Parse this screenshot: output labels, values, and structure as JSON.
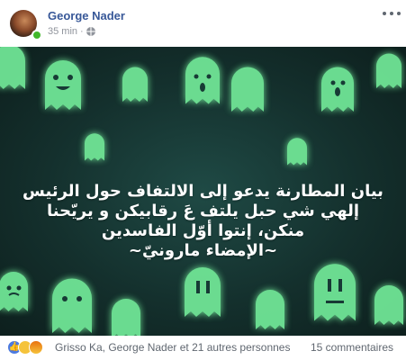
{
  "post": {
    "author": "George Nader",
    "time": "35 min",
    "separator": "·",
    "privacy_icon": "globe-icon",
    "more_icon": "more-options-icon"
  },
  "image": {
    "background_color": "#14302d",
    "ghost_color": "#6fe596",
    "lines": [
      "بيان المطارنة يدعو إلى الالتفاف حول الرئيس",
      "إلهي شي حبل يلتف عَ رقابيكن و يريّحنا",
      "منكن، إنتوا أوّل الفاسدين",
      "~الإمضاء مارونيّ~"
    ]
  },
  "footer": {
    "reaction_icons": [
      "like-icon",
      "haha-icon",
      "angry-icon"
    ],
    "reactors": "Grisso Ka, George Nader et 21 autres personnes",
    "comments": "15 commentaires"
  }
}
